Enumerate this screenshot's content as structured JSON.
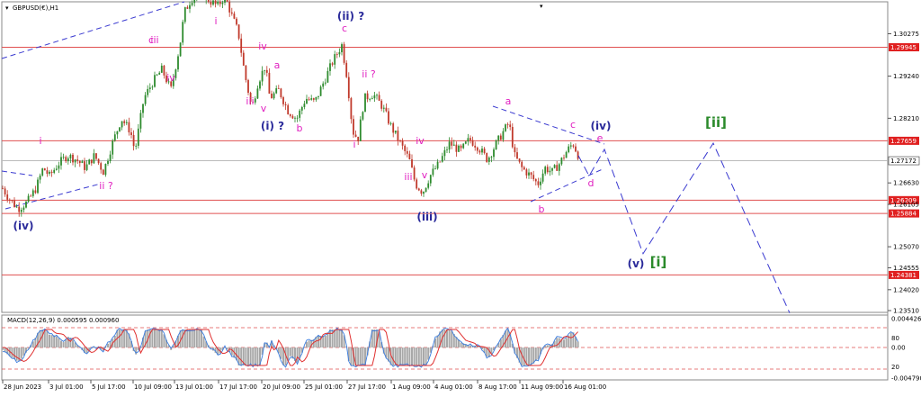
{
  "chart_data": {
    "type": "candlestick",
    "title": "GBPUSD(€),H1",
    "symbol": "GBPUSD",
    "timeframe": "H1",
    "colors": {
      "up": "#2e8b2e",
      "down": "#c0392b",
      "level_line": "#e05050",
      "projection": "#3a3ad0",
      "label_magenta": "#e020c0",
      "label_blue": "#2a2a9a",
      "label_green": "#2a8a2a",
      "macd_hist": "#a8a8a8",
      "macd_line": "#3a7de0",
      "macd_signal": "#e03030"
    },
    "y_axis": {
      "ticks": [
        "1.30275",
        "1.29240",
        "1.28210",
        "1.26630",
        "1.26105",
        "1.25070",
        "1.24555",
        "1.24020",
        "1.23510"
      ],
      "ylim": [
        1.2351,
        1.3066
      ]
    },
    "x_axis": {
      "ticks": [
        "28 Jun 2023",
        "3 Jul 01:00",
        "5 Jul 17:00",
        "10 Jul 09:00",
        "13 Jul 01:00",
        "17 Jul 17:00",
        "20 Jul 09:00",
        "25 Jul 01:00",
        "27 Jul 17:00",
        "1 Aug 09:00",
        "4 Aug 01:00",
        "8 Aug 17:00",
        "11 Aug 09:00",
        "16 Aug 01:00"
      ]
    },
    "levels": [
      {
        "value": "1.29945",
        "y": 1.29945
      },
      {
        "value": "1.27659",
        "y": 1.27659
      },
      {
        "value": "1.26209",
        "y": 1.26209
      },
      {
        "value": "1.25884",
        "y": 1.25884
      },
      {
        "value": "1.24381",
        "y": 1.24381
      }
    ],
    "current_price": {
      "value": "1.27172",
      "y": 1.27172
    },
    "price_path": [
      [
        0,
        1.266
      ],
      [
        10,
        1.2625
      ],
      [
        20,
        1.26
      ],
      [
        30,
        1.2615
      ],
      [
        40,
        1.265
      ],
      [
        48,
        1.27
      ],
      [
        55,
        1.268
      ],
      [
        65,
        1.271
      ],
      [
        75,
        1.273
      ],
      [
        85,
        1.272
      ],
      [
        95,
        1.27
      ],
      [
        105,
        1.273
      ],
      [
        115,
        1.269
      ],
      [
        125,
        1.276
      ],
      [
        135,
        1.282
      ],
      [
        145,
        1.279
      ],
      [
        150,
        1.274
      ],
      [
        160,
        1.287
      ],
      [
        170,
        1.291
      ],
      [
        180,
        1.294
      ],
      [
        190,
        1.289
      ],
      [
        200,
        1.3
      ],
      [
        205,
        1.308
      ],
      [
        212,
        1.311
      ],
      [
        222,
        1.313
      ],
      [
        232,
        1.311
      ],
      [
        242,
        1.3095
      ],
      [
        250,
        1.312
      ],
      [
        258,
        1.307
      ],
      [
        265,
        1.303
      ],
      [
        272,
        1.293
      ],
      [
        280,
        1.2845
      ],
      [
        287,
        1.291
      ],
      [
        295,
        1.295
      ],
      [
        300,
        1.287
      ],
      [
        310,
        1.289
      ],
      [
        320,
        1.284
      ],
      [
        330,
        1.282
      ],
      [
        340,
        1.287
      ],
      [
        350,
        1.286
      ],
      [
        360,
        1.291
      ],
      [
        370,
        1.296
      ],
      [
        380,
        1.3
      ],
      [
        386,
        1.292
      ],
      [
        392,
        1.279
      ],
      [
        398,
        1.277
      ],
      [
        405,
        1.287
      ],
      [
        415,
        1.288
      ],
      [
        425,
        1.285
      ],
      [
        435,
        1.28
      ],
      [
        445,
        1.276
      ],
      [
        455,
        1.272
      ],
      [
        462,
        1.266
      ],
      [
        470,
        1.264
      ],
      [
        478,
        1.268
      ],
      [
        488,
        1.271
      ],
      [
        500,
        1.276
      ],
      [
        512,
        1.274
      ],
      [
        522,
        1.277
      ],
      [
        532,
        1.275
      ],
      [
        542,
        1.272
      ],
      [
        552,
        1.276
      ],
      [
        560,
        1.279
      ],
      [
        566,
        1.281
      ],
      [
        572,
        1.273
      ],
      [
        580,
        1.27
      ],
      [
        590,
        1.268
      ],
      [
        598,
        1.266
      ],
      [
        606,
        1.27
      ],
      [
        614,
        1.269
      ],
      [
        622,
        1.271
      ],
      [
        630,
        1.274
      ],
      [
        637,
        1.276
      ],
      [
        643,
        1.273
      ]
    ],
    "projection_path": [
      [
        643,
        1.273
      ],
      [
        655,
        1.268
      ],
      [
        672,
        1.2745
      ],
      [
        715,
        1.249
      ],
      [
        793,
        1.276
      ],
      [
        878,
        1.2345
      ]
    ],
    "wave_labels": [
      {
        "text": "i",
        "color": "magenta"
      },
      {
        "text": "iii",
        "color": "magenta"
      },
      {
        "text": "iv",
        "color": "magenta"
      },
      {
        "text": "ii ?",
        "color": "magenta"
      },
      {
        "text": "c",
        "color": "magenta"
      },
      {
        "text": "(iv)",
        "color": "blue"
      },
      {
        "text": "i",
        "color": "magenta"
      },
      {
        "text": "iii",
        "color": "magenta"
      },
      {
        "text": "v",
        "color": "magenta"
      },
      {
        "text": "iv",
        "color": "magenta"
      },
      {
        "text": "a",
        "color": "magenta"
      },
      {
        "text": "(i) ?",
        "color": "blue"
      },
      {
        "text": "b",
        "color": "magenta"
      },
      {
        "text": "(ii) ?",
        "color": "blue"
      },
      {
        "text": "c",
        "color": "magenta"
      },
      {
        "text": "ii ?",
        "color": "magenta"
      },
      {
        "text": "i",
        "color": "magenta"
      },
      {
        "text": "iv",
        "color": "magenta"
      },
      {
        "text": "iii",
        "color": "magenta"
      },
      {
        "text": "v",
        "color": "magenta"
      },
      {
        "text": "(iii)",
        "color": "blue"
      },
      {
        "text": "a",
        "color": "magenta"
      },
      {
        "text": "b",
        "color": "magenta"
      },
      {
        "text": "c",
        "color": "magenta"
      },
      {
        "text": "d",
        "color": "magenta"
      },
      {
        "text": "e",
        "color": "magenta"
      },
      {
        "text": "(iv)",
        "color": "blue"
      },
      {
        "text": "(v)",
        "color": "blue"
      },
      {
        "text": "[i]",
        "color": "green"
      },
      {
        "text": "[ii]",
        "color": "green"
      }
    ],
    "macd": {
      "title": "MACD(12,26,9) 0.000595 0.000960",
      "ticks": [
        "0.004426",
        "0.00",
        "-0.004790"
      ],
      "side_labels": [
        "80",
        "20"
      ]
    }
  }
}
